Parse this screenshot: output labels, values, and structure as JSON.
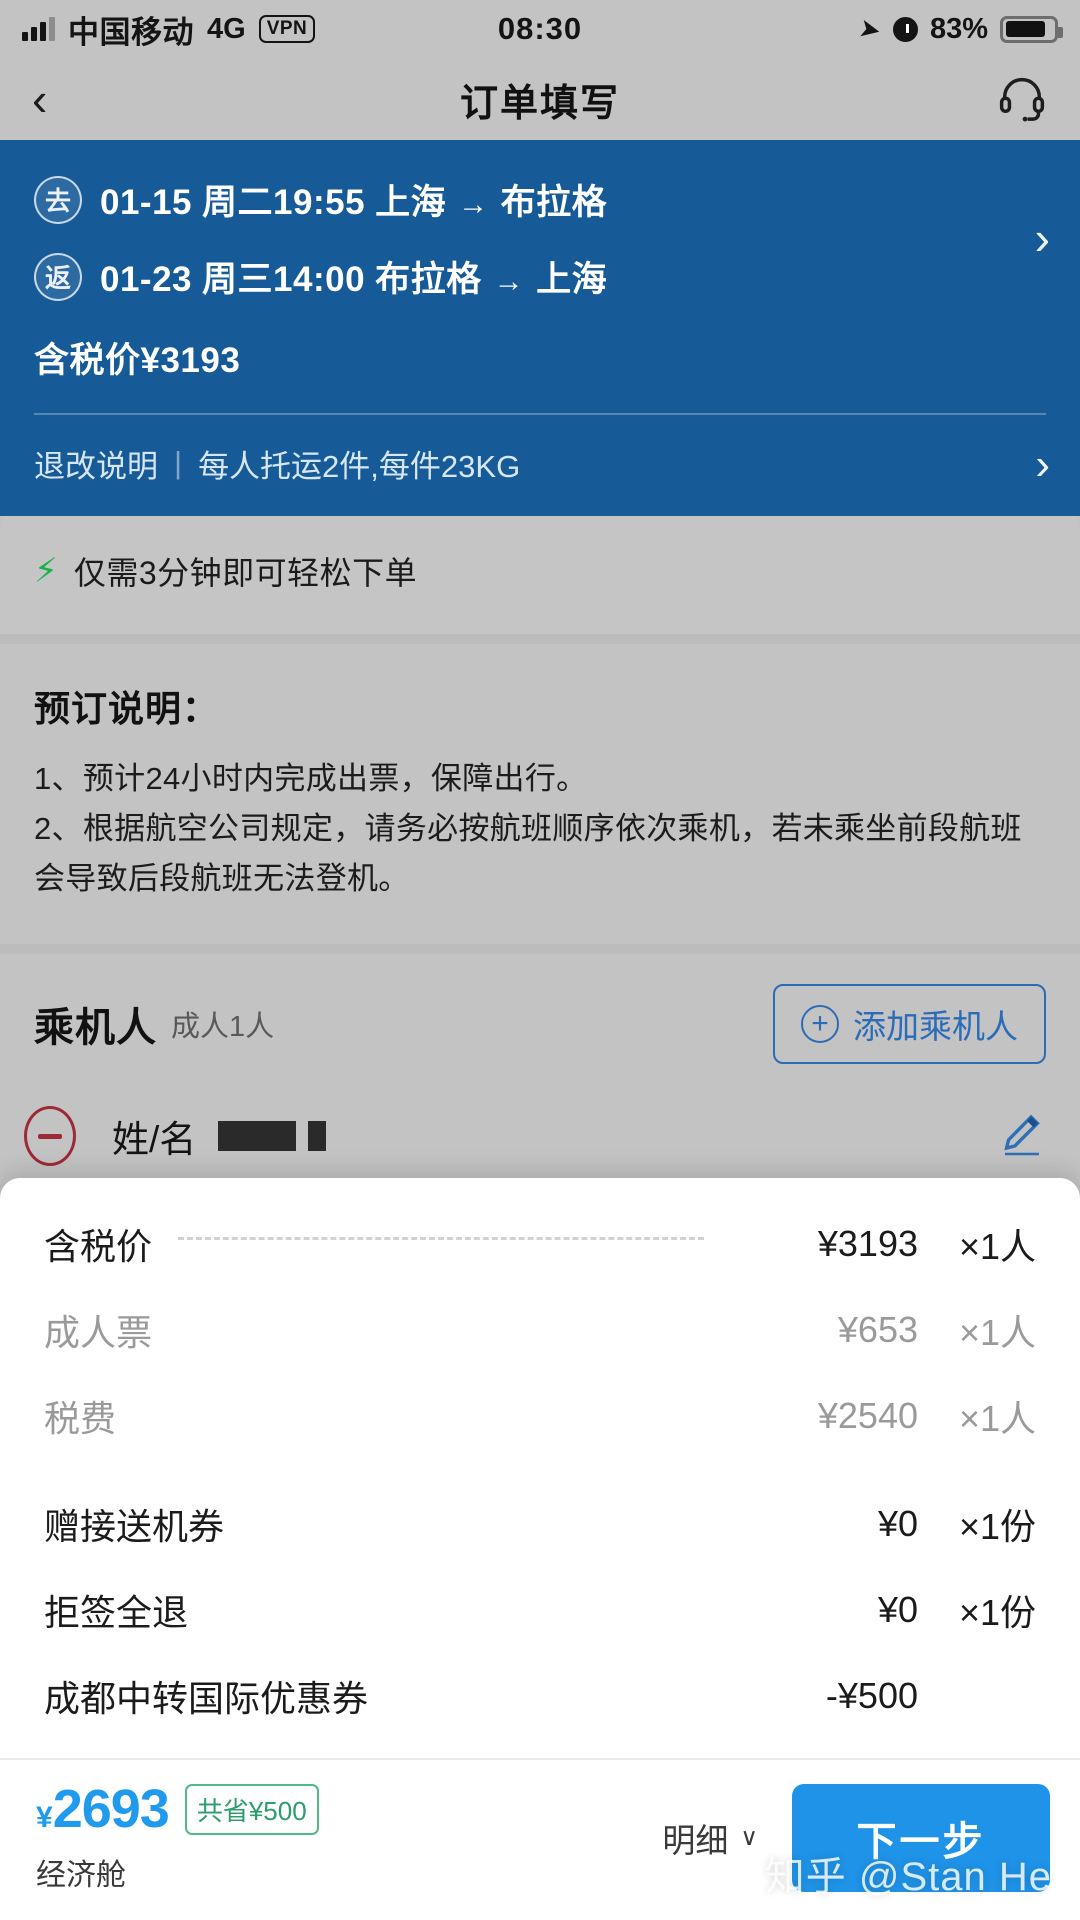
{
  "status_bar": {
    "carrier": "中国移动",
    "network": "4G",
    "vpn": "VPN",
    "time": "08:30",
    "battery_percent": "83%",
    "icons": {
      "signal": "signal-bars-icon",
      "location": "location-arrow-icon",
      "alarm": "alarm-clock-icon",
      "battery": "battery-icon"
    }
  },
  "nav": {
    "back_icon": "‹",
    "title": "订单填写",
    "service_icon": "headset-icon"
  },
  "flight_card": {
    "legs": [
      {
        "badge": "去",
        "date": "01-15",
        "weekday": "周二",
        "time": "19:55",
        "from": "上海",
        "to": "布拉格",
        "arrow": "→"
      },
      {
        "badge": "返",
        "date": "01-23",
        "weekday": "周三",
        "time": "14:00",
        "from": "布拉格",
        "to": "上海",
        "arrow": "→"
      }
    ],
    "price_label": "含税价¥3193",
    "chevron": "›",
    "baggage": {
      "policy_label": "退改说明",
      "separator": "|",
      "baggage_text": "每人托运2件,每件23KG",
      "chevron": "›"
    },
    "bg_color": "#165a97"
  },
  "notice": {
    "icon": "lightning-bolt-icon",
    "text": "仅需3分钟即可轻松下单",
    "icon_color": "#17b34a"
  },
  "booking": {
    "heading": "预订说明：",
    "item1": "1、预计24小时内完成出票，保障出行。",
    "item2": "2、根据航空公司规定，请务必按航班顺序依次乘机，若未乘坐前段航班会导致后段航班无法登机。"
  },
  "passenger": {
    "title": "乘机人",
    "subtitle": "成人1人",
    "add_button": "添加乘机人",
    "add_icon": "plus-circle-icon",
    "remove_icon": "minus-circle-icon",
    "name_label": "姓/名",
    "name_value_redacted": true,
    "edit_icon": "pencil-icon"
  },
  "price_sheet": {
    "rows": [
      {
        "name": "含税价",
        "amount": "¥3193",
        "qty": "×1人",
        "muted": false,
        "dots": true
      },
      {
        "name": "成人票",
        "amount": "¥653",
        "qty": "×1人",
        "muted": true,
        "dots": false
      },
      {
        "name": "税费",
        "amount": "¥2540",
        "qty": "×1人",
        "muted": true,
        "dots": false
      },
      {
        "name": "赠接送机券",
        "amount": "¥0",
        "qty": "×1份",
        "muted": false,
        "dots": false
      },
      {
        "name": "拒签全退",
        "amount": "¥0",
        "qty": "×1份",
        "muted": false,
        "dots": false
      },
      {
        "name": "成都中转国际优惠券",
        "amount": "-¥500",
        "qty": "",
        "muted": false,
        "dots": false
      }
    ]
  },
  "bottom_bar": {
    "currency": "¥",
    "total": "2693",
    "save_badge": "共省¥500",
    "cabin": "经济舱",
    "detail_label": "明细",
    "detail_chevron": "∨",
    "next_button": "下一步",
    "accent_color": "#1f93e8",
    "save_color": "#2e9c6c"
  },
  "watermark": "知乎 @Stan He"
}
